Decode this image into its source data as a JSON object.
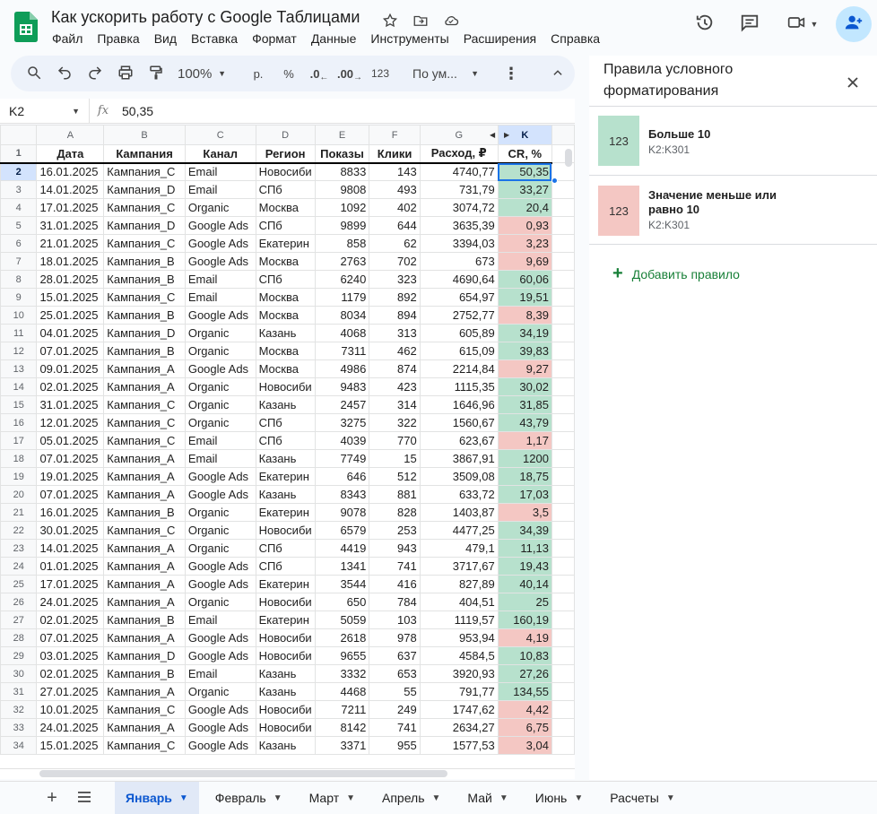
{
  "app": {
    "doc_title": "Как ускорить работу с Google Таблицами",
    "menu": [
      "Файл",
      "Правка",
      "Вид",
      "Вставка",
      "Формат",
      "Данные",
      "Инструменты",
      "Расширения",
      "Справка"
    ]
  },
  "toolbar": {
    "zoom": "100%",
    "currency": "р.",
    "percent": "%",
    "dec_decrease": ".0",
    "dec_increase": ".00",
    "number_format": "123",
    "font": "По ум..."
  },
  "formula": {
    "cell_ref": "K2",
    "fx": "fx",
    "value": "50,35"
  },
  "grid": {
    "column_letters": [
      "A",
      "B",
      "C",
      "D",
      "E",
      "F",
      "G",
      "K"
    ],
    "header_cells": [
      "Дата",
      "Кампания",
      "Канал",
      "Регион",
      "Показы",
      "Клики",
      "Расход, ₽",
      "CR, %"
    ],
    "rows": [
      [
        "16.01.2025",
        "Кампания_C",
        "Email",
        "Новосиби",
        "8833",
        "143",
        "4740,77",
        "50,35"
      ],
      [
        "14.01.2025",
        "Кампания_D",
        "Email",
        "СПб",
        "9808",
        "493",
        "731,79",
        "33,27"
      ],
      [
        "17.01.2025",
        "Кампания_C",
        "Organic",
        "Москва",
        "1092",
        "402",
        "3074,72",
        "20,4"
      ],
      [
        "31.01.2025",
        "Кампания_D",
        "Google Ads",
        "СПб",
        "9899",
        "644",
        "3635,39",
        "0,93"
      ],
      [
        "21.01.2025",
        "Кампания_C",
        "Google Ads",
        "Екатерин",
        "858",
        "62",
        "3394,03",
        "3,23"
      ],
      [
        "18.01.2025",
        "Кампания_B",
        "Google Ads",
        "Москва",
        "2763",
        "702",
        "673",
        "9,69"
      ],
      [
        "28.01.2025",
        "Кампания_B",
        "Email",
        "СПб",
        "6240",
        "323",
        "4690,64",
        "60,06"
      ],
      [
        "15.01.2025",
        "Кампания_C",
        "Email",
        "Москва",
        "1179",
        "892",
        "654,97",
        "19,51"
      ],
      [
        "25.01.2025",
        "Кампания_B",
        "Google Ads",
        "Москва",
        "8034",
        "894",
        "2752,77",
        "8,39"
      ],
      [
        "04.01.2025",
        "Кампания_D",
        "Organic",
        "Казань",
        "4068",
        "313",
        "605,89",
        "34,19"
      ],
      [
        "07.01.2025",
        "Кампания_B",
        "Organic",
        "Москва",
        "7311",
        "462",
        "615,09",
        "39,83"
      ],
      [
        "09.01.2025",
        "Кампания_A",
        "Google Ads",
        "Москва",
        "4986",
        "874",
        "2214,84",
        "9,27"
      ],
      [
        "02.01.2025",
        "Кампания_A",
        "Organic",
        "Новосиби",
        "9483",
        "423",
        "1115,35",
        "30,02"
      ],
      [
        "31.01.2025",
        "Кампания_C",
        "Organic",
        "Казань",
        "2457",
        "314",
        "1646,96",
        "31,85"
      ],
      [
        "12.01.2025",
        "Кампания_C",
        "Organic",
        "СПб",
        "3275",
        "322",
        "1560,67",
        "43,79"
      ],
      [
        "05.01.2025",
        "Кампания_C",
        "Email",
        "СПб",
        "4039",
        "770",
        "623,67",
        "1,17"
      ],
      [
        "07.01.2025",
        "Кампания_A",
        "Email",
        "Казань",
        "7749",
        "15",
        "3867,91",
        "1200"
      ],
      [
        "19.01.2025",
        "Кампания_A",
        "Google Ads",
        "Екатерин",
        "646",
        "512",
        "3509,08",
        "18,75"
      ],
      [
        "07.01.2025",
        "Кампания_A",
        "Google Ads",
        "Казань",
        "8343",
        "881",
        "633,72",
        "17,03"
      ],
      [
        "16.01.2025",
        "Кампания_B",
        "Organic",
        "Екатерин",
        "9078",
        "828",
        "1403,87",
        "3,5"
      ],
      [
        "30.01.2025",
        "Кампания_C",
        "Organic",
        "Новосиби",
        "6579",
        "253",
        "4477,25",
        "34,39"
      ],
      [
        "14.01.2025",
        "Кампания_A",
        "Organic",
        "СПб",
        "4419",
        "943",
        "479,1",
        "11,13"
      ],
      [
        "01.01.2025",
        "Кампания_A",
        "Google Ads",
        "СПб",
        "1341",
        "741",
        "3717,67",
        "19,43"
      ],
      [
        "17.01.2025",
        "Кампания_A",
        "Google Ads",
        "Екатерин",
        "3544",
        "416",
        "827,89",
        "40,14"
      ],
      [
        "24.01.2025",
        "Кампания_A",
        "Organic",
        "Новосиби",
        "650",
        "784",
        "404,51",
        "25"
      ],
      [
        "02.01.2025",
        "Кампания_B",
        "Email",
        "Екатерин",
        "5059",
        "103",
        "1119,57",
        "160,19"
      ],
      [
        "07.01.2025",
        "Кампания_A",
        "Google Ads",
        "Новосиби",
        "2618",
        "978",
        "953,94",
        "4,19"
      ],
      [
        "03.01.2025",
        "Кампания_D",
        "Google Ads",
        "Новосиби",
        "9655",
        "637",
        "4584,5",
        "10,83"
      ],
      [
        "02.01.2025",
        "Кампания_B",
        "Email",
        "Казань",
        "3332",
        "653",
        "3920,93",
        "27,26"
      ],
      [
        "27.01.2025",
        "Кампания_A",
        "Organic",
        "Казань",
        "4468",
        "55",
        "791,77",
        "134,55"
      ],
      [
        "10.01.2025",
        "Кампания_C",
        "Google Ads",
        "Новосиби",
        "7211",
        "249",
        "1747,62",
        "4,42"
      ],
      [
        "24.01.2025",
        "Кампания_A",
        "Google Ads",
        "Новосиби",
        "8142",
        "741",
        "2634,27",
        "6,75"
      ],
      [
        "15.01.2025",
        "Кампания_C",
        "Google Ads",
        "Казань",
        "3371",
        "955",
        "1577,53",
        "3,04"
      ]
    ]
  },
  "panel": {
    "title": "Правила условного форматирования",
    "rules": [
      {
        "preview": "123",
        "name": "Больше 10",
        "range": "K2:K301",
        "color": "#b7e1cd"
      },
      {
        "preview": "123",
        "name": "Значение меньше или равно 10",
        "range": "K2:K301",
        "color": "#f4c7c3"
      }
    ],
    "add_rule": "Добавить правило"
  },
  "sheets": {
    "tabs": [
      "Январь",
      "Февраль",
      "Март",
      "Апрель",
      "Май",
      "Июнь",
      "Расчеты"
    ],
    "active": "Январь"
  },
  "colors": {
    "green": "#b7e1cd",
    "red": "#f4c7c3",
    "accent": "#1a73e8"
  }
}
